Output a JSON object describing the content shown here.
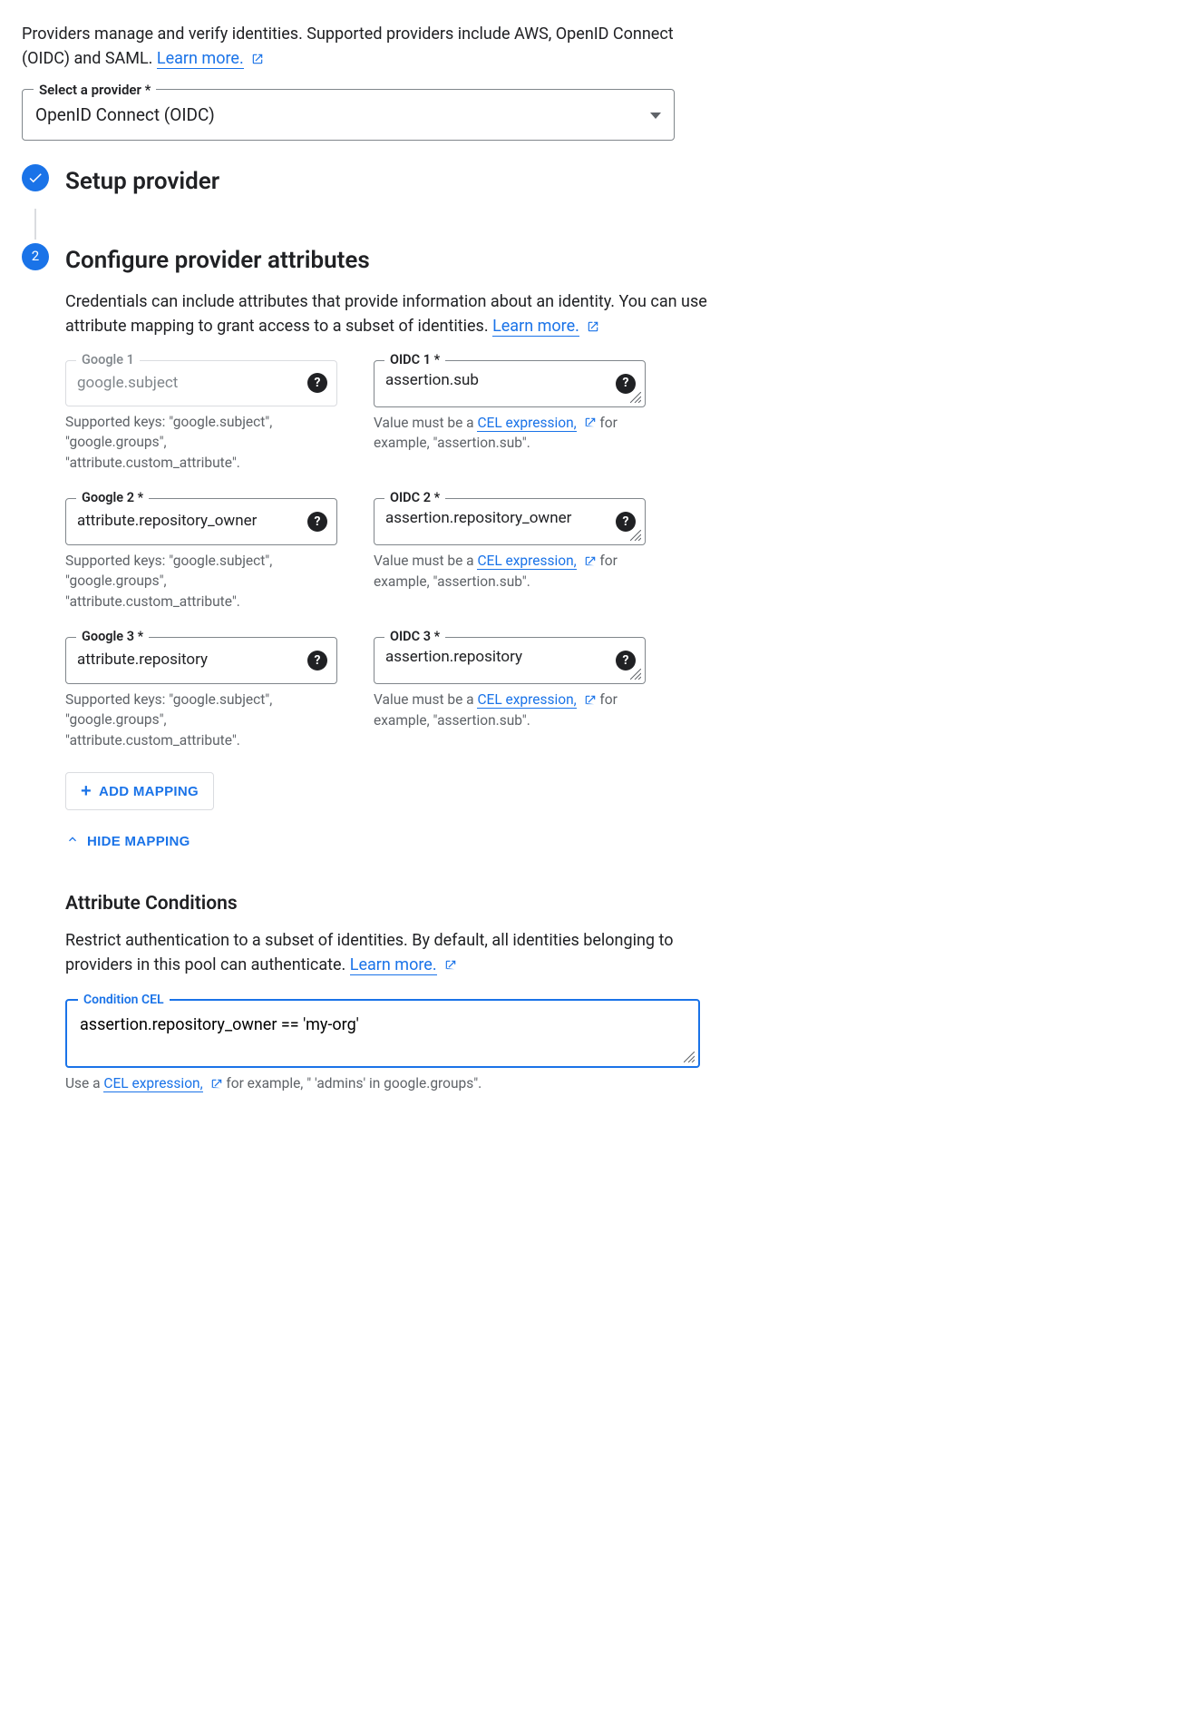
{
  "intro": {
    "text": "Providers manage and verify identities. Supported providers include AWS, OpenID Connect (OIDC) and SAML.",
    "learn_more": "Learn more."
  },
  "provider_select": {
    "label": "Select a provider *",
    "value": "OpenID Connect (OIDC)"
  },
  "steps": {
    "setup": {
      "title": "Setup provider"
    },
    "configure": {
      "number": "2",
      "title": "Configure provider attributes",
      "desc_prefix": "Credentials can include attributes that provide information about an identity. You can use attribute mapping to grant access to a subset of identities.",
      "learn_more": "Learn more."
    }
  },
  "mappings": [
    {
      "google_label": "Google 1",
      "google_value": "google.subject",
      "google_disabled": true,
      "google_hint": "Supported keys: \"google.subject\", \"google.groups\", \"attribute.custom_attribute\".",
      "oidc_label": "OIDC 1 *",
      "oidc_value": "assertion.sub",
      "oidc_hint_pre": "Value must be a ",
      "oidc_hint_link": "CEL expression,",
      "oidc_hint_post": " for example, \"assertion.sub\"."
    },
    {
      "google_label": "Google 2 *",
      "google_value": "attribute.repository_owner",
      "google_disabled": false,
      "google_hint": "Supported keys: \"google.subject\", \"google.groups\", \"attribute.custom_attribute\".",
      "oidc_label": "OIDC 2 *",
      "oidc_value": "assertion.repository_owner",
      "oidc_hint_pre": "Value must be a ",
      "oidc_hint_link": "CEL expression,",
      "oidc_hint_post": " for example, \"assertion.sub\"."
    },
    {
      "google_label": "Google 3 *",
      "google_value": "attribute.repository",
      "google_disabled": false,
      "google_hint": "Supported keys: \"google.subject\", \"google.groups\", \"attribute.custom_attribute\".",
      "oidc_label": "OIDC 3 *",
      "oidc_value": "assertion.repository",
      "oidc_hint_pre": "Value must be a ",
      "oidc_hint_link": "CEL expression,",
      "oidc_hint_post": " for example, \"assertion.sub\"."
    }
  ],
  "buttons": {
    "add_mapping": "ADD MAPPING",
    "hide_mapping": "HIDE MAPPING"
  },
  "conditions": {
    "title": "Attribute Conditions",
    "desc_prefix": "Restrict authentication to a subset of identities. By default, all identities belonging to providers in this pool can authenticate.",
    "learn_more": "Learn more.",
    "cel_label": "Condition CEL",
    "cel_value": "assertion.repository_owner == 'my-org'",
    "hint_pre": "Use a ",
    "hint_link": "CEL expression,",
    "hint_post": " for example, \" 'admins' in google.groups\"."
  }
}
